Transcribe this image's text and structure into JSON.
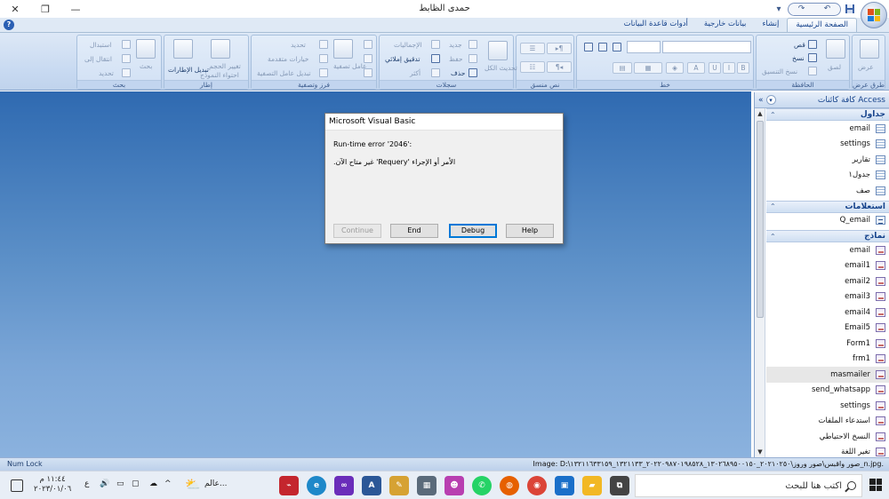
{
  "window": {
    "title": "حمدى الظابط",
    "close_glyph": "✕",
    "restore_glyph": "❐",
    "minimize_glyph": "—"
  },
  "qat": {
    "undo": "↶",
    "redo": "↷",
    "save": "💾",
    "dropdown": "▾"
  },
  "tabs": [
    {
      "label": "الصفحة الرئيسية",
      "active": true
    },
    {
      "label": "إنشاء"
    },
    {
      "label": "بيانات خارجية"
    },
    {
      "label": "أدوات قاعدة البيانات"
    }
  ],
  "ribbon": {
    "groups": {
      "views": {
        "label": "طرق عرض",
        "view_btn": "عرض"
      },
      "clipboard": {
        "label": "الحافظة",
        "paste": "لصق",
        "cut": "قص",
        "copy": "نسخ",
        "format_painter": "نسخ التنسيق"
      },
      "font": {
        "label": "خط"
      },
      "rich_text": {
        "label": "نص منسق"
      },
      "records": {
        "label": "سجلات",
        "refresh_all": "تحديث الكل",
        "new": "جديد",
        "save": "حفظ",
        "delete": "حذف",
        "totals": "الإجماليات",
        "spelling": "تدقيق إملائي",
        "more": "أكثر"
      },
      "sort_filter": {
        "label": "فرز وتصفية",
        "filter": "عامل تصفية",
        "selection": "تحديد",
        "advanced": "خيارات متقدمة",
        "toggle_filter": "تبديل عامل التصفية"
      },
      "window": {
        "label": "إطار",
        "fit_form": "احتواء النموذج",
        "resize": "تغيير الحجم",
        "switch_windows": "تبديل الإطارات"
      },
      "find": {
        "label": "بحث",
        "find": "بحث",
        "replace": "استبدال",
        "goto": "انتقال إلى",
        "select": "تحديد"
      }
    }
  },
  "nav_pane": {
    "title": "كافة كائنات Access",
    "sections": [
      {
        "title": "جداول",
        "icon": "table-icon",
        "items": [
          "email",
          "settings",
          "تقارير",
          "جدول١",
          "صف"
        ]
      },
      {
        "title": "استعلامات",
        "icon": "query-icon",
        "items": [
          "Q_email"
        ]
      },
      {
        "title": "نماذج",
        "icon": "form-icon",
        "items": [
          "email",
          "email1",
          "email2",
          "email3",
          "email4",
          "Email5",
          "Form1",
          "frm1",
          "masmailer",
          "send_whatsapp",
          "settings",
          "استدعاء الملفات",
          "النسخ الاحتياطي",
          "تغير اللغة"
        ],
        "selected": "masmailer"
      }
    ]
  },
  "dialog": {
    "title": "Microsoft Visual Basic",
    "line1": "Run-time error '2046':",
    "line2": "الأمر أو الإجراء 'Requery' غير متاح الآن.",
    "buttons": {
      "continue": "Continue",
      "end": "End",
      "debug": "Debug",
      "help": "Help"
    }
  },
  "statusbar": {
    "left": "Num Lock",
    "right": "Image: D:\\صور واقبس\\صور وروز\\٢٠٢١٠٢٥٠_١٣٠٢٦٨٩٥٠٠١٥٠_٢٠٢٢٠٩٨٧٠١٩٨٥٢٨_١٣٢١١٣٣_١٣٢١١٦٣٣١٥٩_n.jpg."
  },
  "taskbar": {
    "search_placeholder": "اكتب هنا للبحث",
    "weather": "عالم...",
    "time": "١١:٤٤ م",
    "date": "٢٠٢٣/٠١/٠٦",
    "lang": "ع",
    "apps": [
      {
        "name": "taskview-icon",
        "color": "#444",
        "glyph": "⧉"
      },
      {
        "name": "file-explorer-icon",
        "color": "#f2b824",
        "glyph": "▰"
      },
      {
        "name": "store-icon",
        "color": "#1a6fc9",
        "glyph": "▣"
      },
      {
        "name": "chrome-icon",
        "color": "#db4437",
        "glyph": "◉"
      },
      {
        "name": "firefox-icon",
        "color": "#e66000",
        "glyph": "◍"
      },
      {
        "name": "whatsapp-icon",
        "color": "#25d366",
        "glyph": "✆"
      },
      {
        "name": "app-icon",
        "color": "#b83fb0",
        "glyph": "☻"
      },
      {
        "name": "calculator-icon",
        "color": "#5a6a7a",
        "glyph": "▦"
      },
      {
        "name": "paint-icon",
        "color": "#d6a233",
        "glyph": "✎"
      },
      {
        "name": "access-icon",
        "color": "#2b5797",
        "glyph": "A"
      },
      {
        "name": "teams-icon",
        "color": "#6a2dba",
        "glyph": "∞"
      },
      {
        "name": "edge-icon",
        "color": "#1e88c9",
        "glyph": "e"
      },
      {
        "name": "pdf-icon",
        "color": "#c4262e",
        "glyph": "⌁"
      }
    ]
  }
}
